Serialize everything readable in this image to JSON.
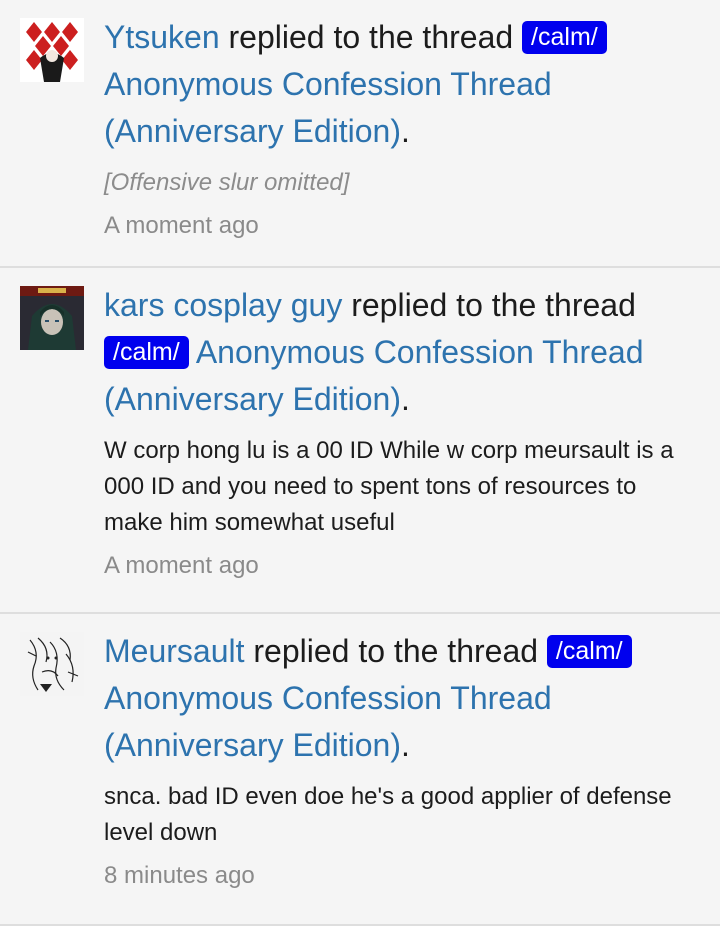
{
  "alerts": [
    {
      "username": "Ytsuken",
      "action_text": " replied to the thread ",
      "prefix": "/calm/",
      "thread_title": "Anonymous Confession Thread (Anniversary Edition)",
      "period": ".",
      "snippet": "[Offensive slur omitted]",
      "time": "A moment ago"
    },
    {
      "username": "kars cosplay guy",
      "action_text": " replied to the thread ",
      "prefix": "/calm/",
      "thread_title": "Anonymous Confession Thread (Anniversary Edition)",
      "period": ".",
      "snippet": "W corp hong lu is a 00 ID While w corp meursault is a 000 ID and you need to spent tons of resources to make him somewhat useful",
      "time": "A moment ago"
    },
    {
      "username": "Meursault",
      "action_text": " replied to the thread ",
      "prefix": "/calm/",
      "thread_title": "Anonymous Confession Thread (Anniversary Edition)",
      "period": ".",
      "snippet": "snca. bad ID even doe he's a good applier of defense level down",
      "time": "8 minutes ago"
    }
  ],
  "colors": {
    "link": "#2d73ae",
    "prefix_bg": "#0000ee",
    "text": "#1c1c1c",
    "muted": "#8a8a8a",
    "background": "#f5f5f5"
  }
}
